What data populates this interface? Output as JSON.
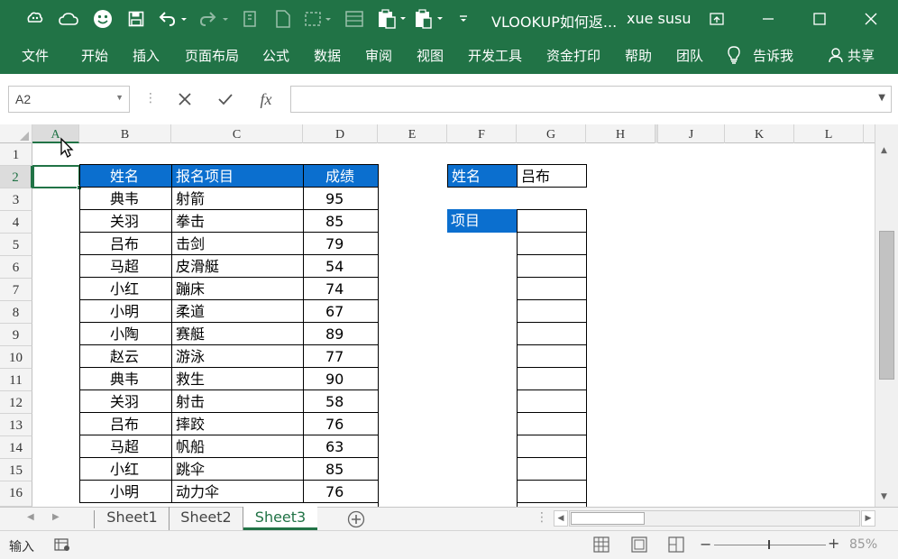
{
  "title_bar": {
    "document_title": "VLOOKUP如何返...",
    "user_name": "xue susu",
    "quick_access_icons": [
      "app-icon",
      "cloud-icon",
      "smiley-icon",
      "save-icon",
      "undo-icon",
      "redo-icon",
      "format-painter-icon",
      "new-sheet-icon",
      "select-icon",
      "form-icon",
      "paste-icon",
      "paste-values-icon",
      "customize-icon"
    ],
    "window_controls": [
      "restore-ribbon-icon",
      "minimize-icon",
      "maximize-icon",
      "close-icon"
    ]
  },
  "menu": {
    "items": [
      "文件",
      "开始",
      "插入",
      "页面布局",
      "公式",
      "数据",
      "审阅",
      "视图",
      "开发工具",
      "资金打印",
      "帮助",
      "团队"
    ],
    "tell_me": "告诉我",
    "share": "共享"
  },
  "formula_bar": {
    "name_box": "A2",
    "formula": "",
    "fx": "fx"
  },
  "columns": [
    "A",
    "B",
    "C",
    "D",
    "E",
    "F",
    "G",
    "H",
    "J",
    "K",
    "L"
  ],
  "rows": [
    "1",
    "2",
    "3",
    "4",
    "5",
    "6",
    "7",
    "8",
    "9",
    "10",
    "11",
    "12",
    "13",
    "14",
    "15",
    "16"
  ],
  "table": {
    "headers": [
      "姓名",
      "报名项目",
      "成绩"
    ],
    "rows": [
      [
        "典韦",
        "射箭",
        "95"
      ],
      [
        "关羽",
        "拳击",
        "85"
      ],
      [
        "吕布",
        "击剑",
        "79"
      ],
      [
        "马超",
        "皮滑艇",
        "54"
      ],
      [
        "小红",
        "蹦床",
        "74"
      ],
      [
        "小明",
        "柔道",
        "67"
      ],
      [
        "小陶",
        "赛艇",
        "89"
      ],
      [
        "赵云",
        "游泳",
        "77"
      ],
      [
        "典韦",
        "救生",
        "90"
      ],
      [
        "关羽",
        "射击",
        "58"
      ],
      [
        "吕布",
        "摔跤",
        "76"
      ],
      [
        "马超",
        "帆船",
        "63"
      ],
      [
        "小红",
        "跳伞",
        "85"
      ],
      [
        "小明",
        "动力伞",
        "76"
      ]
    ]
  },
  "lookup": {
    "name_label": "姓名",
    "name_value": "吕布",
    "item_label": "项目"
  },
  "sheets": [
    "Sheet1",
    "Sheet2",
    "Sheet3"
  ],
  "active_sheet": "Sheet3",
  "status": {
    "mode": "输入",
    "zoom": "85%"
  },
  "colors": {
    "excel_green": "#217346",
    "header_blue": "#0b6fcf"
  }
}
